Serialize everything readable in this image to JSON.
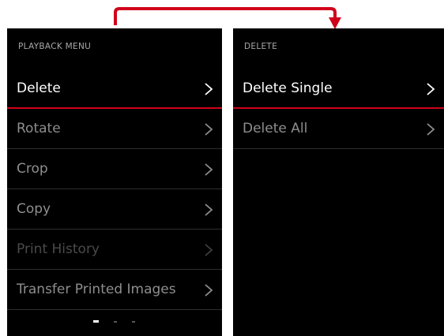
{
  "left_screen": {
    "header": "PLAYBACK MENU",
    "items": [
      {
        "label": "Delete",
        "state": "active"
      },
      {
        "label": "Rotate",
        "state": "normal"
      },
      {
        "label": "Crop",
        "state": "normal"
      },
      {
        "label": "Copy",
        "state": "normal"
      },
      {
        "label": "Print History",
        "state": "disabled"
      },
      {
        "label": "Transfer Printed Images",
        "state": "normal"
      }
    ],
    "pagination": {
      "pages": 3,
      "current": 1
    }
  },
  "right_screen": {
    "header": "DELETE",
    "items": [
      {
        "label": "Delete Single",
        "state": "active"
      },
      {
        "label": "Delete All",
        "state": "normal"
      }
    ]
  },
  "colors": {
    "accent": "#d0021b",
    "screen_bg": "#000000",
    "text_active": "#ffffff",
    "text_normal": "#8e8e8e",
    "text_disabled": "#4a4a4a"
  },
  "icons": {
    "item_arrow": "chevron-right-icon",
    "flow_arrow": "red-flow-arrow"
  }
}
